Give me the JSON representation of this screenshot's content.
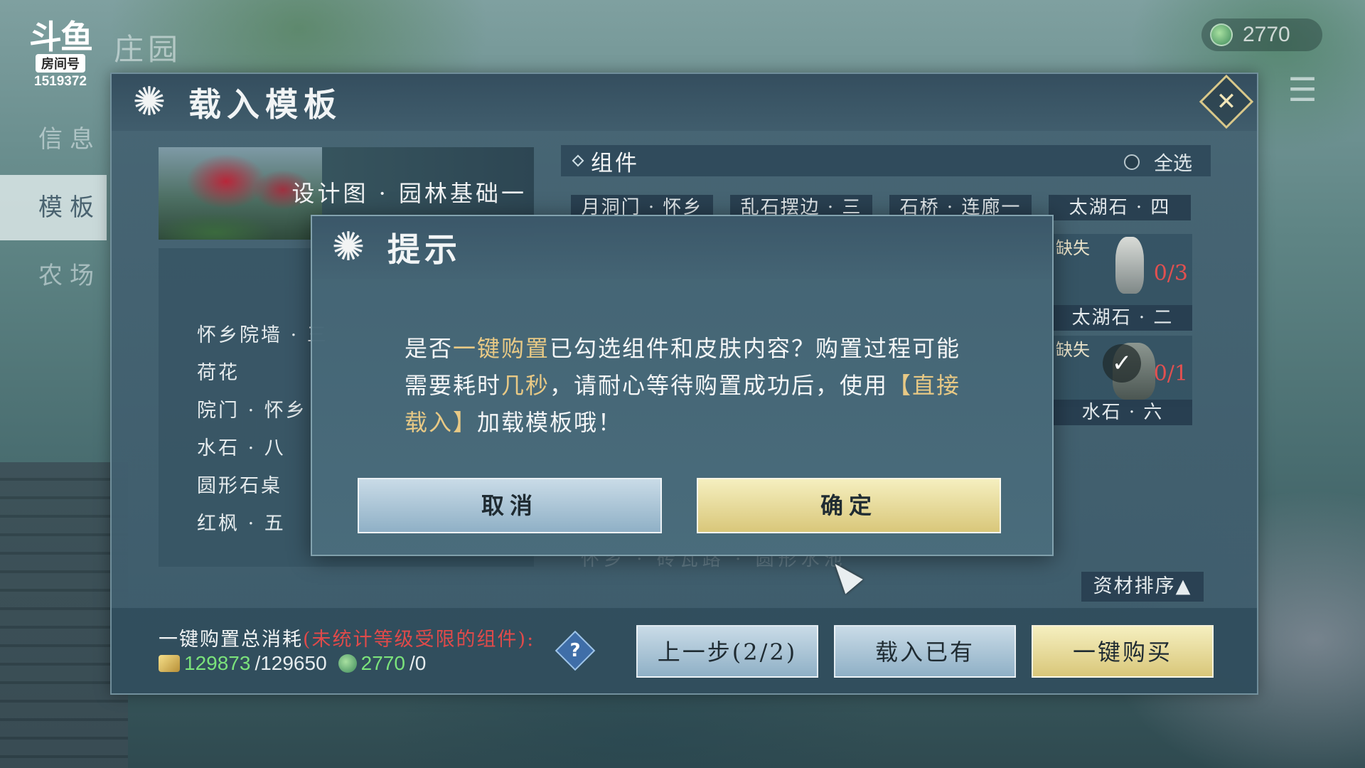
{
  "overlay": {
    "logo_mark": "斗鱼",
    "logo_tag": "房间号",
    "room_number": "1519372"
  },
  "scene": {
    "title": "庄园"
  },
  "currency": {
    "icon": "jade-coin-icon",
    "value": "2770"
  },
  "sidenav": {
    "items": [
      {
        "label": "信息",
        "active": false
      },
      {
        "label": "模板",
        "active": true
      },
      {
        "label": "农场",
        "active": false
      }
    ]
  },
  "panel": {
    "title": "载入模板",
    "close_icon": "close-icon",
    "preview_title": "设计图 · 园林基础一",
    "list_items": [
      "怀乡院墙 · 三",
      "荷花",
      "院门 · 怀乡",
      "水石 · 八",
      "圆形石桌",
      "红枫 · 五"
    ],
    "components": {
      "title": "组件",
      "select_all": "全选",
      "tiles": [
        "月洞门 · 怀乡",
        "乱石摆边 · 三",
        "石桥 · 连廊一",
        "太湖石 · 四"
      ],
      "cards": [
        {
          "missing": "缺失",
          "name": "太湖石 · 二",
          "count": "0/3",
          "checked": false
        },
        {
          "missing": "缺失",
          "name": "水石 · 六",
          "count": "0/1",
          "checked": true
        }
      ]
    },
    "faded_row": "怀乡 · 砖瓦路 · 圆形水池",
    "sort_label": "资材排序▲",
    "footer": {
      "cost_label": "一键购置总消耗",
      "cost_note": "(未统计等级受限的组件):",
      "gold_current": "129873",
      "gold_total": "/129650",
      "jade_current": "2770",
      "jade_total": "/0",
      "help": "?",
      "prev_button": "上一步(2/2)",
      "load_existing_button": "载入已有",
      "buy_all_button": "一键购买"
    }
  },
  "modal": {
    "title": "提示",
    "body_1": "是否",
    "body_hl_1": "一键购置",
    "body_2": "已勾选组件和皮肤内容？购置过程可能需要耗时",
    "body_hl_2": "几秒",
    "body_3": "，请耐心等待购置成功后，使用",
    "body_hl_3": "【直接载入】",
    "body_4": "加载模板哦！",
    "cancel_button": "取消",
    "confirm_button": "确定"
  },
  "colors": {
    "highlight": "#e8c985",
    "warning": "#e04a4a",
    "currency_green": "#7be37b",
    "button_gold": "#d9c77a",
    "button_blue": "#8fb0c6"
  }
}
